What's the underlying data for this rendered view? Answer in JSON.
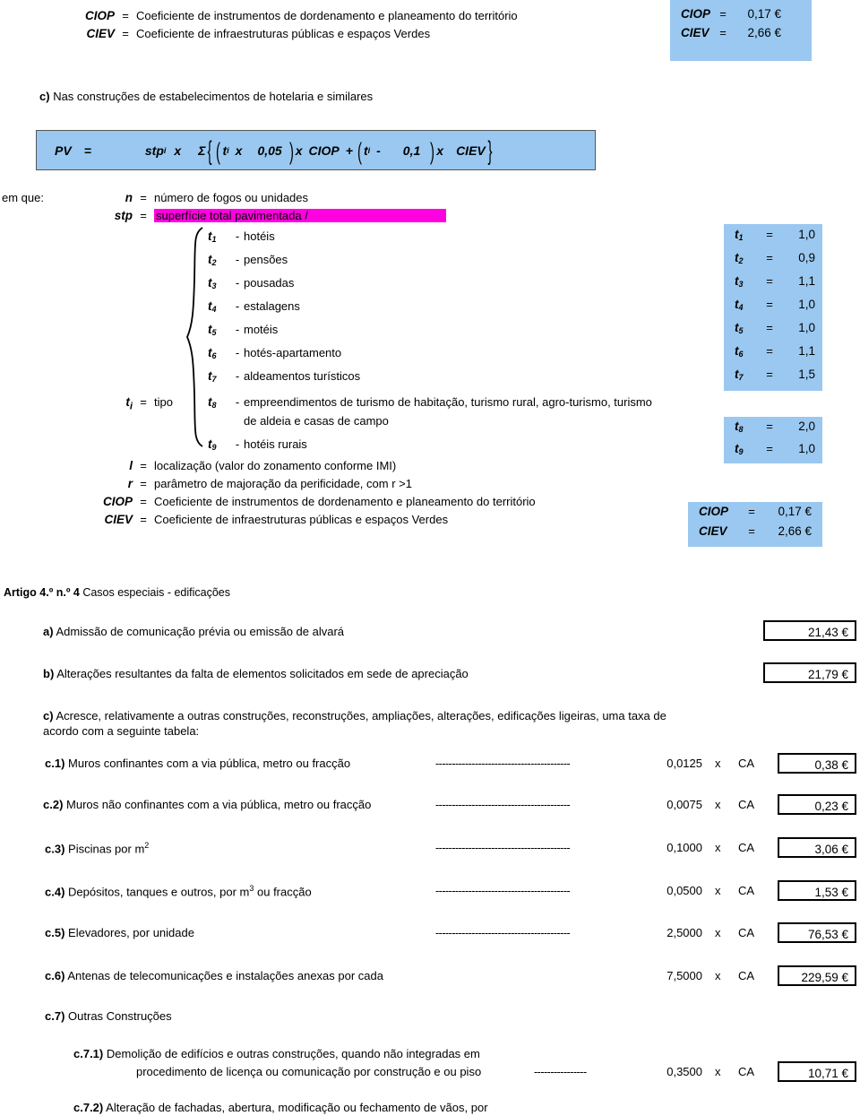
{
  "header": {
    "definitions": [
      {
        "key": "CIOP",
        "eq": "=",
        "text": "Coeficiente de instrumentos de dordenamento e planeamento do território"
      },
      {
        "key": "CIEV",
        "eq": "=",
        "text": "Coeficiente de infraestruturas públicas e espaços Verdes"
      }
    ],
    "values": [
      {
        "key": "CIOP",
        "eq": "=",
        "value": "0,17 €"
      },
      {
        "key": "CIEV",
        "eq": "=",
        "value": "2,66 €"
      }
    ]
  },
  "section_c": {
    "heading_marker": "c)",
    "heading_text": "Nas construções de estabelecimentos de hotelaria e similares",
    "formula": {
      "pv": "PV",
      "eq": "=",
      "stp": "stp",
      "stp_sub": "i",
      "x1": "x",
      "sigma": "Σ",
      "t_a": "t",
      "t_a_sub": "i",
      "x2": "x",
      "n005": "0,05",
      "x3": "x",
      "ciop": "CIOP",
      "plus": "+",
      "t_b": "t",
      "t_b_sub": "i",
      "minus": "-",
      "n01": "0,1",
      "x4": "x",
      "ciev": "CIEV"
    }
  },
  "em_que": {
    "label": "em que:",
    "n": {
      "key": "n",
      "eq": "=",
      "text": "número de fogos ou unidades"
    },
    "stp": {
      "key": "stp",
      "eq": "=",
      "text": "superfície total pavimentada /",
      "highlight": "#ff00e0"
    },
    "ti": {
      "key": "t",
      "key_sub": "i",
      "eq": "=",
      "text": "tipo"
    },
    "types": [
      {
        "n": "1",
        "dash": "-",
        "label": "hotéis"
      },
      {
        "n": "2",
        "dash": "-",
        "label": "pensões"
      },
      {
        "n": "3",
        "dash": "-",
        "label": "pousadas"
      },
      {
        "n": "4",
        "dash": "-",
        "label": "estalagens"
      },
      {
        "n": "5",
        "dash": "-",
        "label": "motéis"
      },
      {
        "n": "6",
        "dash": "-",
        "label": "hotés-apartamento"
      },
      {
        "n": "7",
        "dash": "-",
        "label": "aldeamentos turísticos"
      },
      {
        "n": "8",
        "dash": "-",
        "label": "empreendimentos de turismo de habitação, turismo rural, agro-turismo, turismo",
        "label2": "de aldeia e casas de campo"
      },
      {
        "n": "9",
        "dash": "-",
        "label": "hotéis rurais"
      }
    ],
    "type_values": [
      {
        "key": "t",
        "sub": "1",
        "eq": "=",
        "value": "1,0"
      },
      {
        "key": "t",
        "sub": "2",
        "eq": "=",
        "value": "0,9"
      },
      {
        "key": "t",
        "sub": "3",
        "eq": "=",
        "value": "1,1"
      },
      {
        "key": "t",
        "sub": "4",
        "eq": "=",
        "value": "1,0"
      },
      {
        "key": "t",
        "sub": "5",
        "eq": "=",
        "value": "1,0"
      },
      {
        "key": "t",
        "sub": "6",
        "eq": "=",
        "value": "1,1"
      },
      {
        "key": "t",
        "sub": "7",
        "eq": "=",
        "value": "1,5"
      }
    ],
    "type_values_2": [
      {
        "key": "t",
        "sub": "8",
        "eq": "=",
        "value": "2,0"
      },
      {
        "key": "t",
        "sub": "9",
        "eq": "=",
        "value": "1,0"
      }
    ],
    "tail": [
      {
        "key": "l",
        "eq": "=",
        "text": "localização (valor do zonamento conforme IMI)"
      },
      {
        "key": "r",
        "eq": "=",
        "text": "parâmetro de majoração da perificidade, com r >1"
      },
      {
        "key": "CIOP",
        "eq": "=",
        "text": "Coeficiente de instrumentos de dordenamento e planeamento do território"
      },
      {
        "key": "CIEV",
        "eq": "=",
        "text": "Coeficiente de infraestruturas públicas e espaços Verdes"
      }
    ],
    "tail_values": [
      {
        "key": "CIOP",
        "eq": "=",
        "value": "0,17 €"
      },
      {
        "key": "CIEV",
        "eq": "=",
        "value": "2,66 €"
      }
    ]
  },
  "artigo": {
    "title_bold": "Artigo 4.º n.º 4",
    "title_rest": "Casos especiais - edificações",
    "items": [
      {
        "marker": "a)",
        "text": "Admissão de comunicação prévia ou emissão de alvará",
        "value": "21,43 €"
      },
      {
        "marker": "b)",
        "text": "Alterações resultantes da falta de elementos solicitados em sede de apreciação",
        "value": "21,79 €"
      }
    ],
    "c_marker": "c)",
    "c_line1": "Acresce, relativamente a outras construções, reconstruções, ampliações, alterações, edificações ligeiras, uma taxa de",
    "c_line2": "acordo com a seguinte tabela:",
    "rows": [
      {
        "marker": "c.1)",
        "text": "Muros confinantes com a via pública, metro ou fracção",
        "dots": "-----------------------------------------",
        "coef": "0,0125",
        "x": "x",
        "ca": "CA",
        "value": "0,38 €"
      },
      {
        "marker": "c.2)",
        "text": "Muros não confinantes com a via pública, metro ou fracção",
        "dots": "-----------------------------------------",
        "coef": "0,0075",
        "x": "x",
        "ca": "CA",
        "value": "0,23 €"
      },
      {
        "marker": "c.3)",
        "text": "Piscinas por m",
        "sup": "2",
        "dots": "-----------------------------------------",
        "coef": "0,1000",
        "x": "x",
        "ca": "CA",
        "value": "3,06 €"
      },
      {
        "marker": "c.4)",
        "text": "Depósitos, tanques e outros, por m",
        "sup": "3",
        "text_after": " ou fracção",
        "dots": "-----------------------------------------",
        "coef": "0,0500",
        "x": "x",
        "ca": "CA",
        "value": "1,53 €"
      },
      {
        "marker": "c.5)",
        "text": "Elevadores, por unidade",
        "dots": "-----------------------------------------",
        "coef": "2,5000",
        "x": "x",
        "ca": "CA",
        "value": "76,53 €"
      },
      {
        "marker": "c.6)",
        "text": "Antenas de telecomunicações e instalações anexas  por cada",
        "dots": "",
        "coef": "7,5000",
        "x": "x",
        "ca": "CA",
        "value": "229,59 €"
      }
    ],
    "c7_marker": "c.7)",
    "c7_text": "Outras Construções",
    "c71_marker": "c.7.1)",
    "c71_line1": "Demolição de edifícios e outras construções, quando não integradas em",
    "c71_line2": "procedimento de licença ou comunicação por construção e ou piso",
    "c71_dots": "----------------",
    "c71_coef": "0,3500",
    "c71_x": "x",
    "c71_ca": "CA",
    "c71_value": "10,71 €",
    "c72_marker": "c.7.2)",
    "c72_text": "Alteração de fachadas, abertura, modificação ou fechamento de vãos, por"
  }
}
